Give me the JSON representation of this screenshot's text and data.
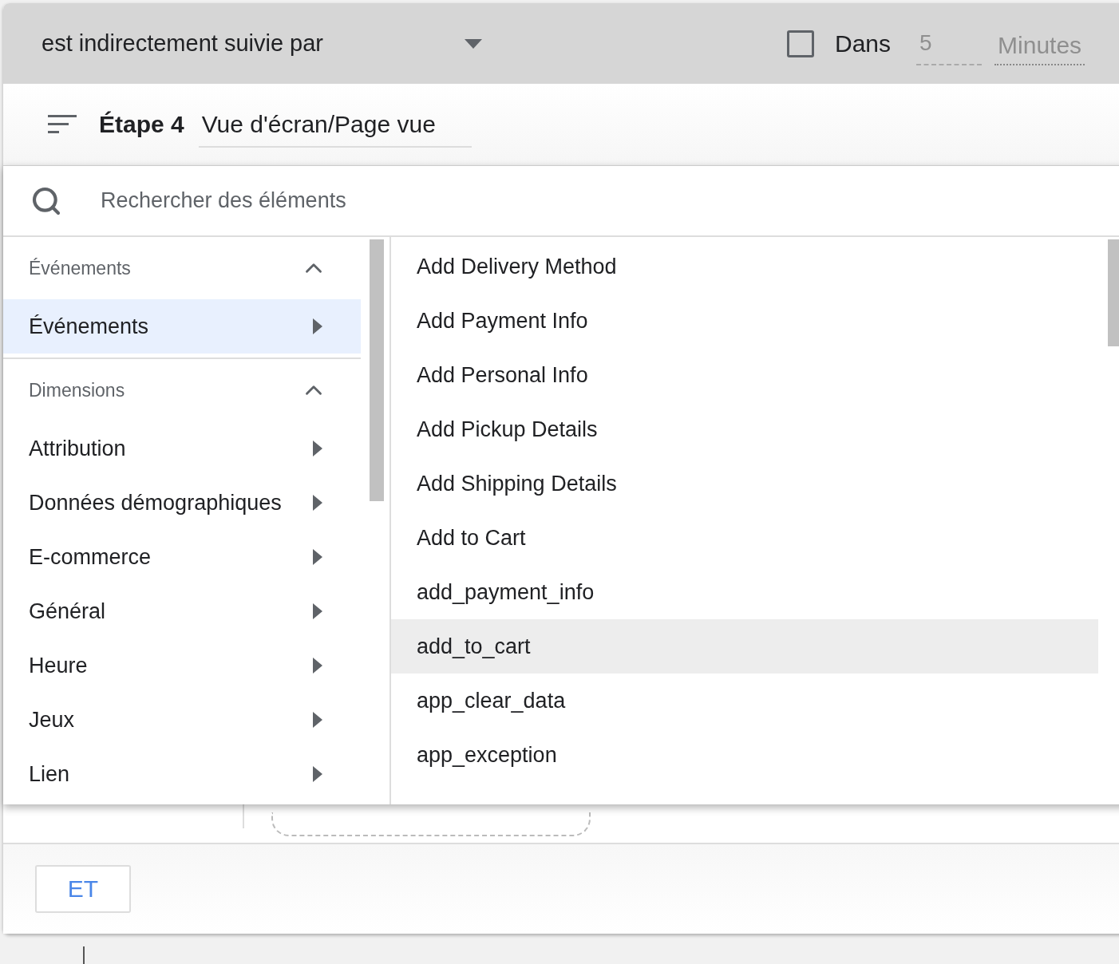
{
  "condition": {
    "value": "est indirectement suivie par"
  },
  "within": {
    "checked": false,
    "label": "Dans",
    "value": "5",
    "unit": "Minutes"
  },
  "step": {
    "label": "Étape 4",
    "value": "Vue d'écran/Page vue"
  },
  "search": {
    "placeholder": "Rechercher des éléments"
  },
  "categories": [
    {
      "title": "Événements",
      "expanded": true,
      "items": [
        {
          "label": "Événements",
          "selected": true
        }
      ]
    },
    {
      "title": "Dimensions",
      "expanded": true,
      "items": [
        {
          "label": "Attribution",
          "selected": false
        },
        {
          "label": "Données démographiques",
          "selected": false
        },
        {
          "label": "E-commerce",
          "selected": false
        },
        {
          "label": "Général",
          "selected": false
        },
        {
          "label": "Heure",
          "selected": false
        },
        {
          "label": "Jeux",
          "selected": false
        },
        {
          "label": "Lien",
          "selected": false
        }
      ]
    }
  ],
  "elements": [
    {
      "label": "Add Delivery Method",
      "hovered": false
    },
    {
      "label": "Add Payment Info",
      "hovered": false
    },
    {
      "label": "Add Personal Info",
      "hovered": false
    },
    {
      "label": "Add Pickup Details",
      "hovered": false
    },
    {
      "label": "Add Shipping Details",
      "hovered": false
    },
    {
      "label": "Add to Cart",
      "hovered": false
    },
    {
      "label": "add_payment_info",
      "hovered": false
    },
    {
      "label": "add_to_cart",
      "hovered": true
    },
    {
      "label": "app_clear_data",
      "hovered": false
    },
    {
      "label": "app_exception",
      "hovered": false
    }
  ],
  "and_button": "ET"
}
